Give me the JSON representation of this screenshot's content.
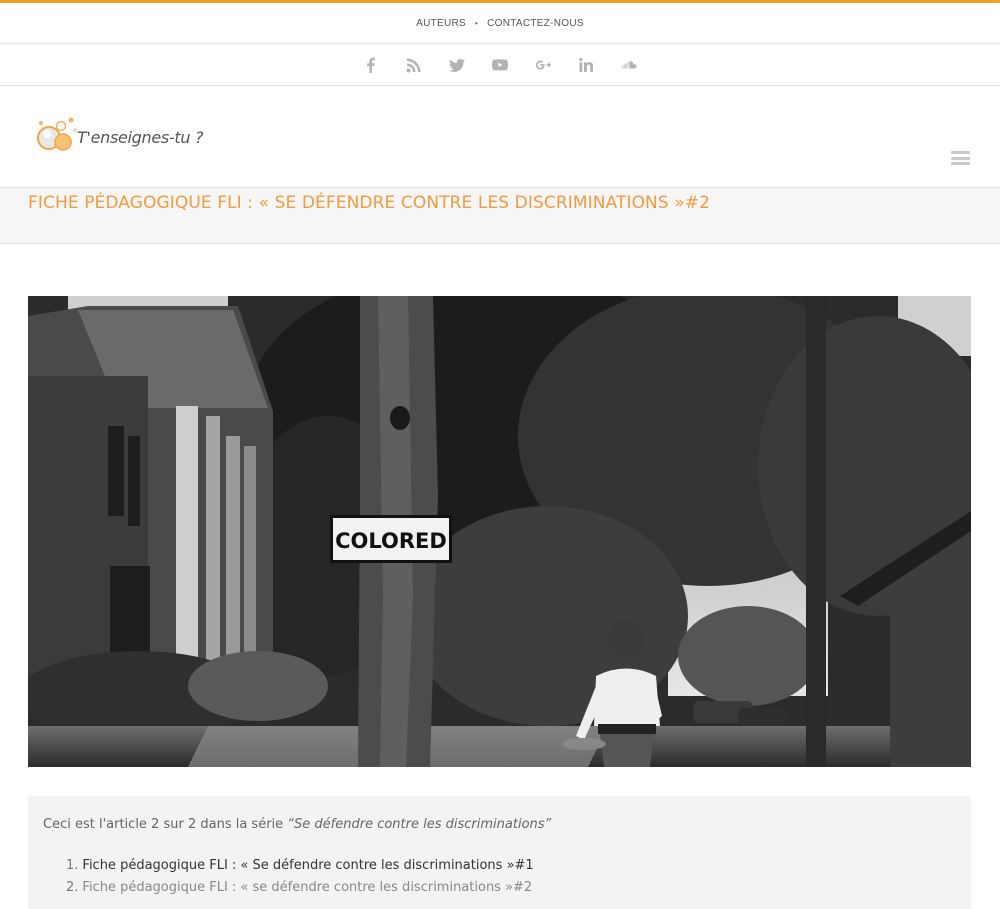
{
  "topnav": {
    "items": [
      "AUTEURS",
      "CONTACTEZ-NOUS"
    ],
    "separator": "•"
  },
  "social": {
    "icons": [
      "facebook-icon",
      "rss-icon",
      "twitter-icon",
      "youtube-icon",
      "google-plus-icon",
      "linkedin-icon",
      "soundcloud-icon"
    ],
    "color": "#b3b3b3"
  },
  "header": {
    "logo_text": "T'enseignes-tu ?"
  },
  "page": {
    "title": "FICHE PÉDAGOGIQUE FLI : « SE DÉFENDRE CONTRE LES DISCRIMINATIONS »#2",
    "title_color": "#f29a3e"
  },
  "hero": {
    "sign_text": "COLORED"
  },
  "series": {
    "intro_prefix": "Ceci est l'article 2 sur 2 dans la série ",
    "intro_series": "“Se défendre contre les discriminations”",
    "items": [
      {
        "num": "1.",
        "label": "Fiche pédagogique FLI : « Se défendre contre les discriminations »#1"
      },
      {
        "num": "2.",
        "label": "Fiche pédagogique FLI : « se défendre contre les discriminations »#2"
      }
    ]
  },
  "colors": {
    "accent": "#f0a227",
    "title": "#f29a3e"
  }
}
